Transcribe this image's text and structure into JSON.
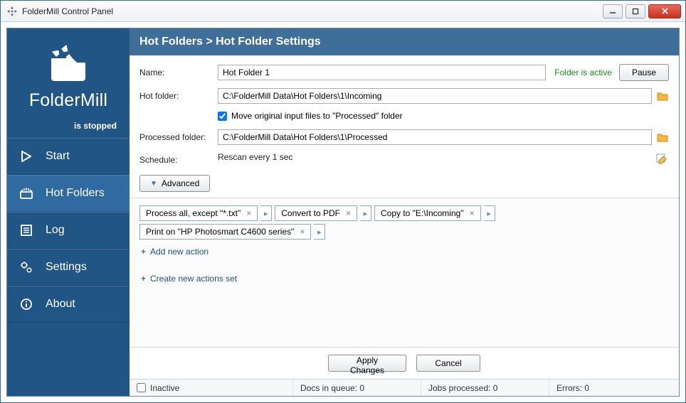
{
  "window": {
    "title": "FolderMill Control Panel"
  },
  "brand": {
    "name": "FolderMill",
    "status": "is stopped"
  },
  "nav": {
    "start": "Start",
    "hotfolders": "Hot Folders",
    "log": "Log",
    "settings": "Settings",
    "about": "About"
  },
  "header": {
    "breadcrumb": "Hot Folders > Hot Folder Settings"
  },
  "form": {
    "name_label": "Name:",
    "name_value": "Hot Folder 1",
    "active_status": "Folder is active",
    "pause_btn": "Pause",
    "hotfolder_label": "Hot folder:",
    "hotfolder_value": "C:\\FolderMill Data\\Hot Folders\\1\\Incoming",
    "move_checkbox": "Move original input files to \"Processed\" folder",
    "processed_label": "Processed folder:",
    "processed_value": "C:\\FolderMill Data\\Hot Folders\\1\\Processed",
    "schedule_label": "Schedule:",
    "schedule_value": "Rescan every 1 sec",
    "advanced_btn": "Advanced"
  },
  "actions": {
    "chips": [
      "Process all, except \"*.txt\"",
      "Convert to PDF",
      "Copy to \"E:\\Incoming\"",
      "Print on \"HP Photosmart C4600 series\""
    ],
    "add_action": "Add new action",
    "create_set": "Create new actions set"
  },
  "footer": {
    "apply": "Apply Changes",
    "cancel": "Cancel"
  },
  "status": {
    "inactive": "Inactive",
    "docs": "Docs in queue: 0",
    "jobs": "Jobs processed: 0",
    "errors": "Errors: 0"
  }
}
